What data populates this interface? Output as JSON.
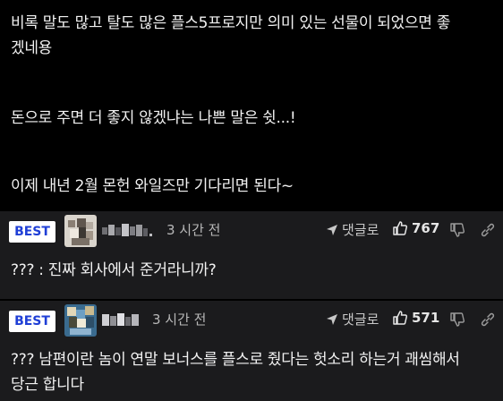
{
  "post": {
    "lines": [
      "비록 말도 많고 탈도 많은 플스5프로지만 의미 있는 선물이 되었으면 좋",
      "겠네용",
      "돈으로 주면 더 좋지 않겠냐는 나쁜 말은 쉿...!",
      "이제 내년 2월 몬헌 와일즈만 기다리면 된다~"
    ]
  },
  "comments": [
    {
      "badge": "BEST",
      "time": "3 시간 전",
      "reply_label": "댓글로",
      "likes": "767",
      "text": "??? : 진짜 회사에서 준거라니까?"
    },
    {
      "badge": "BEST",
      "time": "3 시간 전",
      "reply_label": "댓글로",
      "likes": "571",
      "text_lines": [
        "??? 남편이란 놈이 연말 보너스를 플스로 줬다는 헛소리 하는거 괘씸해서",
        "당근 합니다"
      ]
    }
  ],
  "colors": {
    "background": "#000000",
    "comment_bg": "#1b1b1d",
    "badge_text": "#1f3fd6",
    "badge_bg": "#ffffff"
  },
  "icons": [
    "reply-arrow-icon",
    "thumbs-up-icon",
    "thumbs-down-icon",
    "link-icon"
  ]
}
